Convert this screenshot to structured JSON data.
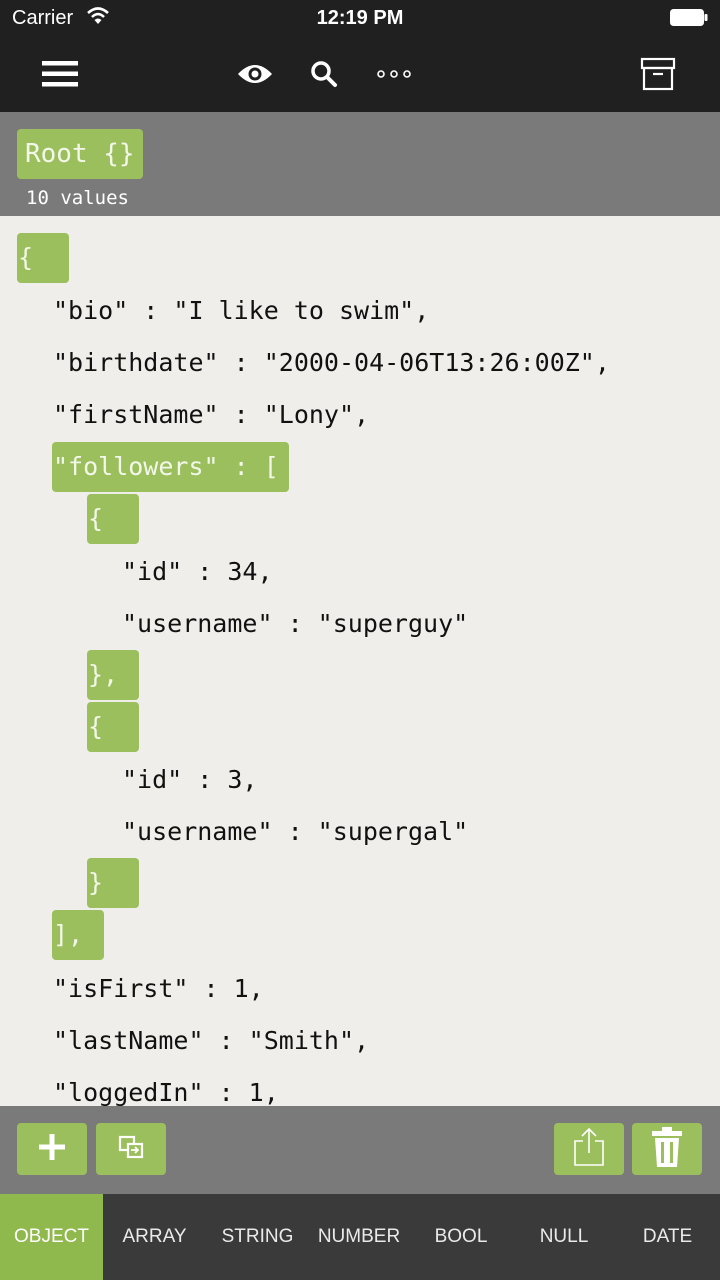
{
  "status_bar": {
    "carrier": "Carrier",
    "time": "12:19 PM"
  },
  "toolbar": {
    "icons": [
      "menu-icon",
      "eye-icon",
      "search-icon",
      "more-icon",
      "archive-icon"
    ]
  },
  "header": {
    "root_label": "Root {}",
    "value_count": "10 values"
  },
  "json_lines": [
    "{",
    "\"bio\" : \"I like to swim\",",
    "\"birthdate\" : \"2000-04-06T13:26:00Z\",",
    "\"firstName\" : \"Lony\",",
    "\"followers\" : [",
    "{",
    "\"id\" : 34,",
    "\"username\" : \"superguy\"",
    "},",
    "{",
    "\"id\" : 3,",
    "\"username\" : \"supergal\"",
    "}",
    "],",
    "\"isFirst\" : 1,",
    "\"lastName\" : \"Smith\",",
    "\"loggedIn\" : 1,"
  ],
  "action_bar": {
    "icons": [
      "add-icon",
      "copy-icon",
      "share-icon",
      "trash-icon"
    ]
  },
  "type_tabs": [
    "OBJECT",
    "ARRAY",
    "STRING",
    "NUMBER",
    "BOOL",
    "NULL",
    "DATE"
  ],
  "selected_type": "OBJECT",
  "colors": {
    "accent": "#9bbf5c",
    "bar_dark": "#202020",
    "header_gray": "#7a7a7a",
    "content_bg": "#f0eeea",
    "tab_bar": "#3a3a3a"
  }
}
